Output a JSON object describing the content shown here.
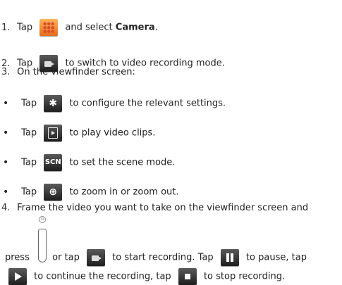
{
  "steps": {
    "s1": {
      "num": "1.",
      "pre": "Tap",
      "post": "and select",
      "bold": "Camera",
      "end": ".",
      "icon": "apps-grid-icon"
    },
    "s2": {
      "num": "2.",
      "pre": "Tap",
      "post": "to switch to video recording mode.",
      "icon": "camcorder-icon"
    },
    "s3": {
      "num": "3.",
      "text": "On the viewfinder screen:"
    },
    "s4": {
      "num": "4.",
      "line1": "Frame the video you want to take on the viewfinder screen and",
      "press": "press",
      "or_tap": "or tap",
      "start": "to start recording. Tap",
      "pause": "to pause, tap",
      "cont": "to continue the recording, tap",
      "stop": "to stop recording."
    }
  },
  "bullets": [
    {
      "pre": "Tap",
      "post": "to configure the relevant settings.",
      "icon": "settings-gear-icon"
    },
    {
      "pre": "Tap",
      "post": "to play video clips.",
      "icon": "play-clips-icon"
    },
    {
      "pre": "Tap",
      "post": "to set the scene mode.",
      "icon": "scn-icon",
      "icon_label": "SCN"
    },
    {
      "pre": "Tap",
      "post": "to zoom in or zoom out.",
      "icon": "zoom-icon"
    }
  ],
  "bullet_char": "•"
}
